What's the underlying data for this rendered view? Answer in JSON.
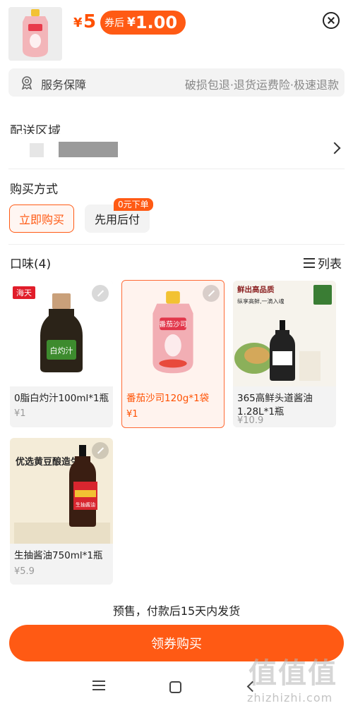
{
  "header": {
    "price_currency": "¥",
    "price": "5",
    "coupon_label": "券后",
    "coupon_currency": "¥",
    "coupon_price": "1.00"
  },
  "service": {
    "label": "服务保障",
    "description": "破损包退·退货运费险·极速退款"
  },
  "delivery": {
    "label": "配送区域"
  },
  "purchase": {
    "title": "购买方式",
    "options": [
      {
        "label": "立即购买",
        "selected": true
      },
      {
        "label": "先用后付",
        "selected": false,
        "badge": "0元下单"
      }
    ]
  },
  "flavor": {
    "title": "口味(4)",
    "view_toggle": "列表",
    "items": [
      {
        "name": "0脂白灼汁100ml*1瓶",
        "price": "¥1",
        "selected": false
      },
      {
        "name": "番茄沙司120g*1袋",
        "price": "¥1",
        "selected": true
      },
      {
        "name": "365高鲜头道酱油1.28L*1瓶",
        "price": "¥10.9",
        "selected": false
      },
      {
        "name": "生抽酱油750ml*1瓶",
        "price": "¥5.9",
        "selected": false
      }
    ]
  },
  "images": {
    "brand_logo": "海天",
    "item1_label": "白灼汁",
    "item2_label": "番茄沙司",
    "item3_title": "鲜出高品质",
    "item3_subtitle": "纵享高鲜,一滴入魂",
    "item4_title": "优选黄豆酿造生抽",
    "item4_bottle": "生抽酱油"
  },
  "footer": {
    "notice": "预售，付款后15天内发货",
    "main_button": "领券购买"
  },
  "watermark": {
    "logo": "值值值",
    "text": "zhizhizhi.com"
  },
  "colors": {
    "accent": "#ff5a14",
    "price": "#ff5000"
  }
}
